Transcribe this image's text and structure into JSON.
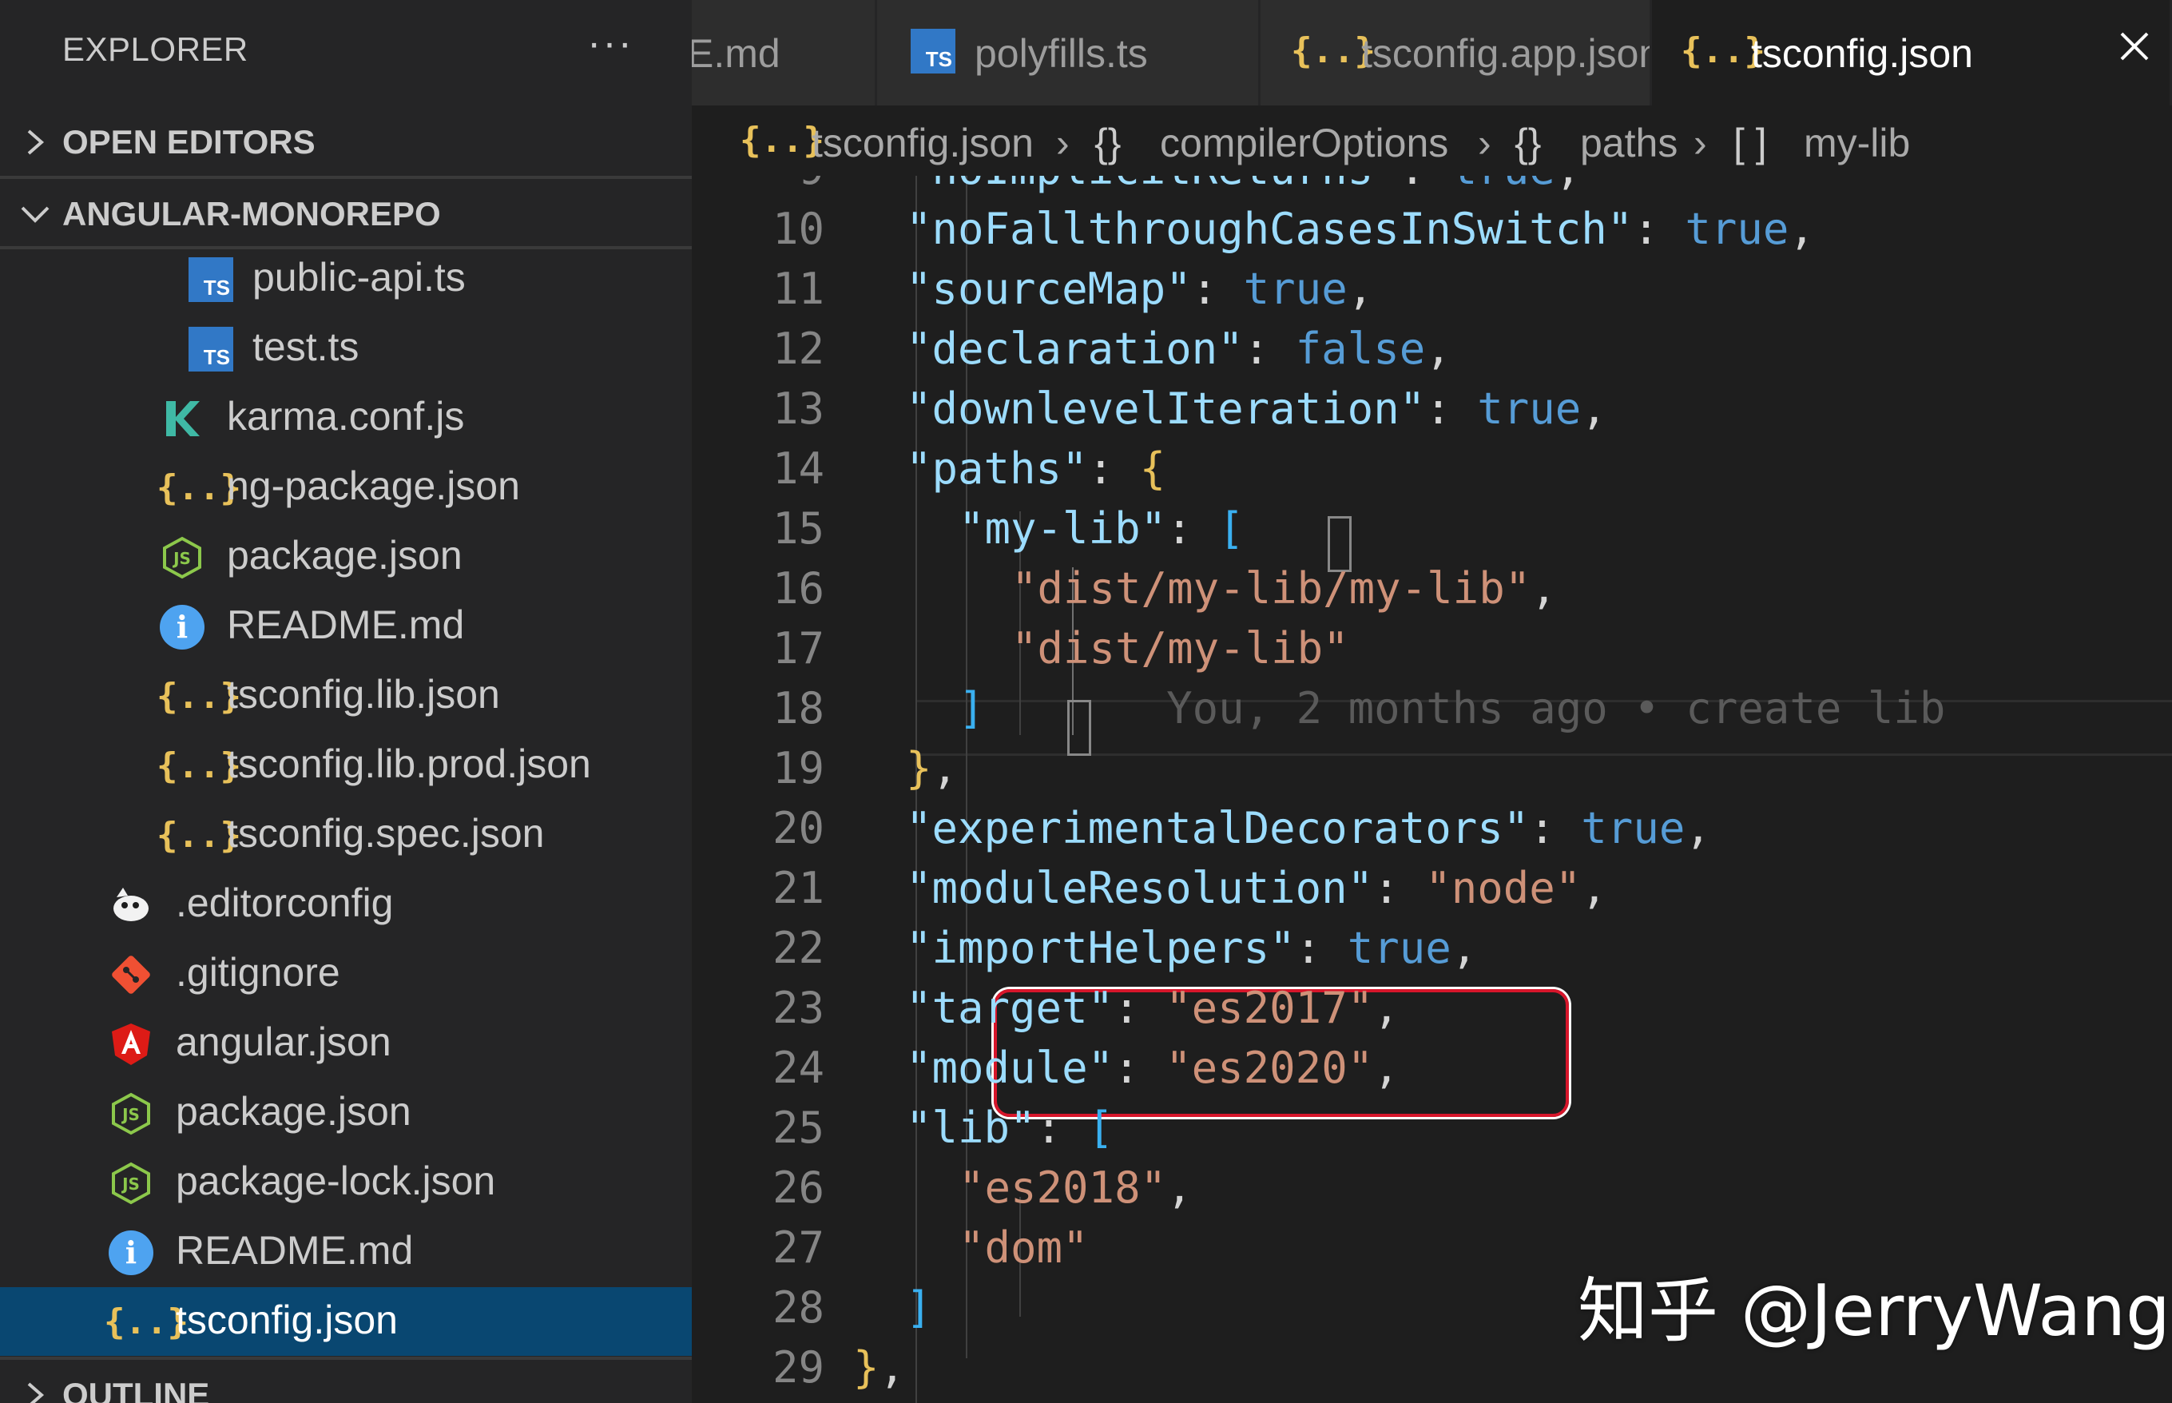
{
  "sidebar": {
    "title": "EXPLORER",
    "more_label": "···",
    "sections": {
      "open_editors": "OPEN EDITORS",
      "project": "ANGULAR-MONOREPO",
      "outline": "OUTLINE"
    },
    "files": [
      {
        "name": "public-api.ts",
        "icon": "ts-icon"
      },
      {
        "name": "test.ts",
        "icon": "ts-icon"
      },
      {
        "name": "karma.conf.js",
        "icon": "karma-icon"
      },
      {
        "name": "ng-package.json",
        "icon": "json-icon"
      },
      {
        "name": "package.json",
        "icon": "nodejs-icon"
      },
      {
        "name": "README.md",
        "icon": "info-icon"
      },
      {
        "name": "tsconfig.lib.json",
        "icon": "json-icon"
      },
      {
        "name": "tsconfig.lib.prod.json",
        "icon": "json-icon"
      },
      {
        "name": "tsconfig.spec.json",
        "icon": "json-icon"
      },
      {
        "name": ".editorconfig",
        "icon": "editorconfig-icon"
      },
      {
        "name": ".gitignore",
        "icon": "git-icon"
      },
      {
        "name": "angular.json",
        "icon": "angular-icon"
      },
      {
        "name": "package.json",
        "icon": "nodejs-icon"
      },
      {
        "name": "package-lock.json",
        "icon": "nodejs-icon"
      },
      {
        "name": "README.md",
        "icon": "info-icon"
      },
      {
        "name": "tsconfig.json",
        "icon": "json-icon",
        "selected": true
      }
    ]
  },
  "tabs": [
    {
      "label": "E.md",
      "icon": "",
      "active": false
    },
    {
      "label": "polyfills.ts",
      "icon": "ts-icon",
      "active": false
    },
    {
      "label": "tsconfig.app.json",
      "icon": "json-icon",
      "active": false
    },
    {
      "label": "tsconfig.json",
      "icon": "json-icon",
      "active": true
    }
  ],
  "breadcrumb": {
    "file": "tsconfig.json",
    "item1_icon": "{}",
    "item1": "compilerOptions",
    "item2_icon": "{}",
    "item2": "paths",
    "item3_icon": "[ ]",
    "item3": "my-lib"
  },
  "editor": {
    "lines": [
      {
        "num": "9",
        "text": "\"noImplicitReturns\": true,"
      },
      {
        "num": "10",
        "text": "\"noFallthroughCasesInSwitch\": true,"
      },
      {
        "num": "11",
        "text": "\"sourceMap\": true,"
      },
      {
        "num": "12",
        "text": "\"declaration\": false,"
      },
      {
        "num": "13",
        "text": "\"downlevelIteration\": true,"
      },
      {
        "num": "14",
        "text": "\"paths\": {"
      },
      {
        "num": "15",
        "text": "\"my-lib\": ["
      },
      {
        "num": "16",
        "text": "\"dist/my-lib/my-lib\","
      },
      {
        "num": "17",
        "text": "\"dist/my-lib\""
      },
      {
        "num": "18",
        "text": "]"
      },
      {
        "num": "19",
        "text": "},"
      },
      {
        "num": "20",
        "text": "\"experimentalDecorators\": true,"
      },
      {
        "num": "21",
        "text": "\"moduleResolution\": \"node\","
      },
      {
        "num": "22",
        "text": "\"importHelpers\": true,"
      },
      {
        "num": "23",
        "text": "\"target\": \"es2017\","
      },
      {
        "num": "24",
        "text": "\"module\": \"es2020\","
      },
      {
        "num": "25",
        "text": "\"lib\": ["
      },
      {
        "num": "26",
        "text": "\"es2018\","
      },
      {
        "num": "27",
        "text": "\"dom\""
      },
      {
        "num": "28",
        "text": "]"
      },
      {
        "num": "29",
        "text": "},"
      }
    ],
    "blame": "You, 2 months ago • create lib"
  },
  "watermark": "知乎 @JerryWang",
  "colors": {
    "sidebar_bg": "#252526",
    "editor_bg": "#1e1e1e",
    "selection_bg": "#094771",
    "key": "#9cdcfe",
    "string": "#ce9178",
    "boolean": "#569cd6",
    "highlight_border": "#d7162b"
  }
}
